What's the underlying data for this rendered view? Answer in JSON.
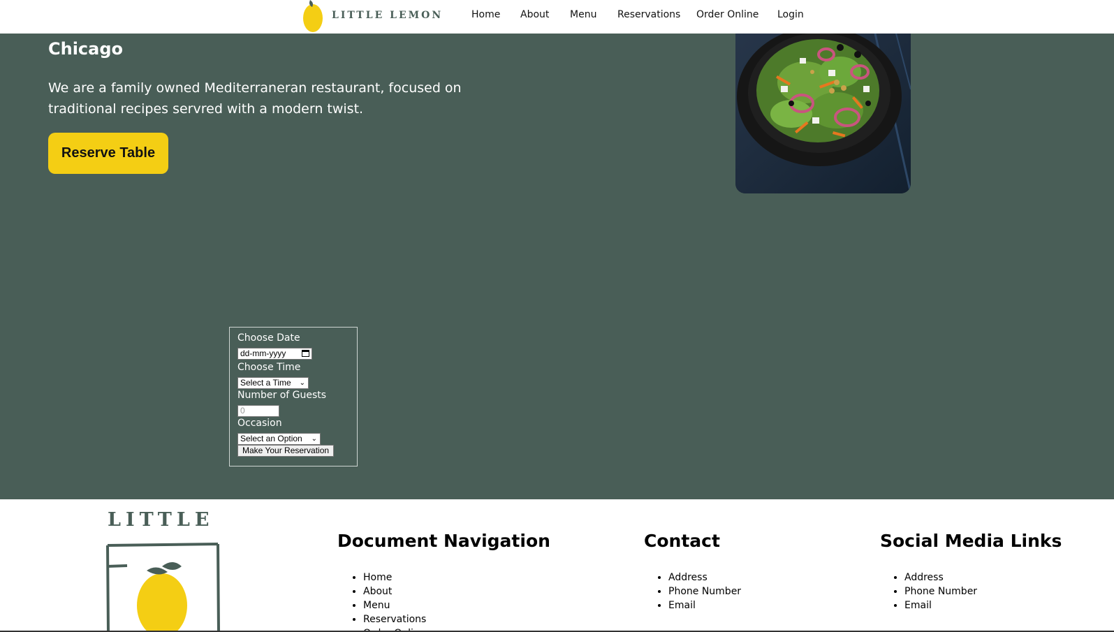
{
  "brand": {
    "logo_text": "LITTLE LEMON",
    "footer_logo_text": "LITTLE"
  },
  "nav": {
    "items": [
      {
        "label": "Home"
      },
      {
        "label": "About"
      },
      {
        "label": "Menu"
      },
      {
        "label": "Reservations"
      },
      {
        "label": "Order Online"
      },
      {
        "label": "Login"
      }
    ]
  },
  "hero": {
    "city": "Chicago",
    "description": "We are a family owned Mediterraneran restaurant, focused on traditional recipes servred with a modern twist.",
    "cta_label": "Reserve Table"
  },
  "booking_form": {
    "date_label": "Choose Date",
    "date_placeholder": "dd-mm-yyyy",
    "time_label": "Choose Time",
    "time_value": "Select a Time",
    "guests_label": "Number of Guests",
    "guests_value": "0",
    "occasion_label": "Occasion",
    "occasion_value": "Select an Option",
    "submit_label": "Make Your Reservation"
  },
  "footer": {
    "navigation": {
      "title": "Document Navigation",
      "items": [
        "Home",
        "About",
        "Menu",
        "Reservations",
        "Order Online"
      ]
    },
    "contact": {
      "title": "Contact",
      "items": [
        "Address",
        "Phone Number",
        "Email"
      ]
    },
    "social": {
      "title": "Social Media Links",
      "items": [
        "Address",
        "Phone Number",
        "Email"
      ]
    }
  },
  "colors": {
    "primary_green": "#495e57",
    "primary_yellow": "#f4ce14",
    "white": "#ffffff"
  },
  "icons": {
    "logo": "lemon-icon",
    "dish": "salad-bowl-image",
    "date_picker": "calendar-icon",
    "dropdown": "chevron-down-icon"
  }
}
